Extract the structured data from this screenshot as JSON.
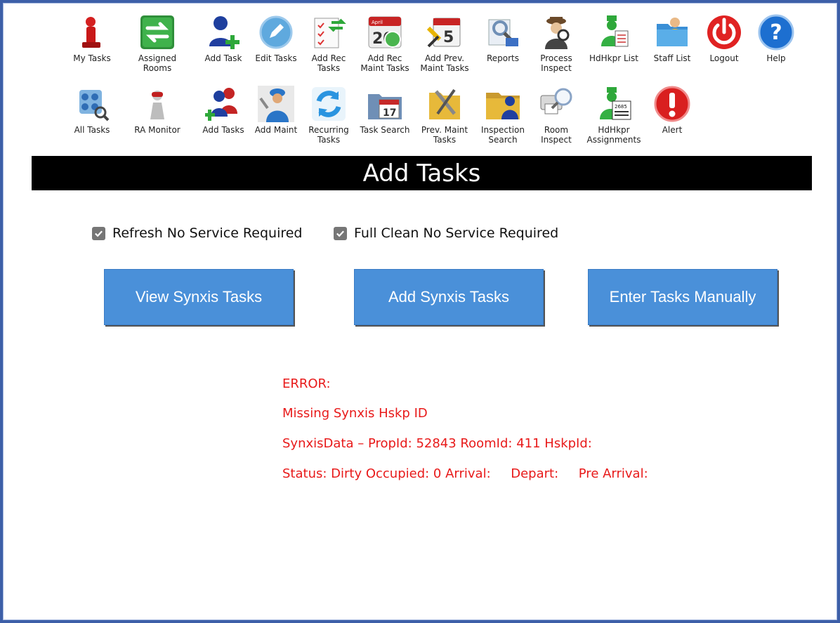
{
  "nav_row1": [
    {
      "label": "My Tasks",
      "icon": "my-tasks-icon"
    },
    {
      "label": "Assigned Rooms",
      "icon": "assigned-rooms-icon"
    },
    {
      "label": "Add Task",
      "icon": "add-task-icon"
    },
    {
      "label": "Edit Tasks",
      "icon": "edit-tasks-icon"
    },
    {
      "label": "Add Rec\nTasks",
      "icon": "add-rec-tasks-icon"
    },
    {
      "label": "Add Rec\nMaint Tasks",
      "icon": "add-rec-maint-tasks-icon"
    },
    {
      "label": "Add Prev.\nMaint Tasks",
      "icon": "add-prev-maint-tasks-icon"
    },
    {
      "label": "Reports",
      "icon": "reports-icon"
    },
    {
      "label": "Process\nInspect",
      "icon": "process-inspect-icon"
    },
    {
      "label": "HdHkpr List",
      "icon": "hdhkpr-list-icon"
    },
    {
      "label": "Staff List",
      "icon": "staff-list-icon"
    },
    {
      "label": "Logout",
      "icon": "logout-icon"
    },
    {
      "label": "Help",
      "icon": "help-icon"
    }
  ],
  "nav_row2": [
    {
      "label": "All Tasks",
      "icon": "all-tasks-icon"
    },
    {
      "label": "RA Monitor",
      "icon": "ra-monitor-icon"
    },
    {
      "label": "Add Tasks",
      "icon": "add-tasks-icon"
    },
    {
      "label": "Add Maint",
      "icon": "add-maint-icon"
    },
    {
      "label": "Recurring\nTasks",
      "icon": "recurring-tasks-icon"
    },
    {
      "label": "Task Search",
      "icon": "task-search-icon"
    },
    {
      "label": "Prev. Maint\nTasks",
      "icon": "prev-maint-tasks-icon"
    },
    {
      "label": "Inspection\nSearch",
      "icon": "inspection-search-icon"
    },
    {
      "label": "Room\nInspect",
      "icon": "room-inspect-icon"
    },
    {
      "label": "HdHkpr\nAssignments",
      "icon": "hdhkpr-assignments-icon"
    },
    {
      "label": "Alert",
      "icon": "alert-icon"
    }
  ],
  "calendar_icon_text": {
    "month": "April",
    "day": "20",
    "day2": "17",
    "day3": "5",
    "badge": "2685"
  },
  "page_title": "Add Tasks",
  "options": {
    "refresh_label": "Refresh No Service Required",
    "refresh_checked": true,
    "full_clean_label": "Full Clean No Service Required",
    "full_clean_checked": true
  },
  "buttons": {
    "view_synxis": "View Synxis Tasks",
    "add_synxis": "Add Synxis Tasks",
    "enter_manually": "Enter Tasks Manually"
  },
  "error": {
    "heading": "ERROR:",
    "message": "Missing Synxis Hskp ID",
    "synxis_data": "SynxisData – PropId: 52843 RoomId: 411 HskpId:",
    "status": "Status: Dirty Occupied: 0 Arrival:     Depart:     Pre Arrival:"
  },
  "colors": {
    "title_bar_bg": "#000000",
    "button_bg": "#4a90d9",
    "error_text": "#e81a1a",
    "frame_border": "#3d5fa8"
  }
}
